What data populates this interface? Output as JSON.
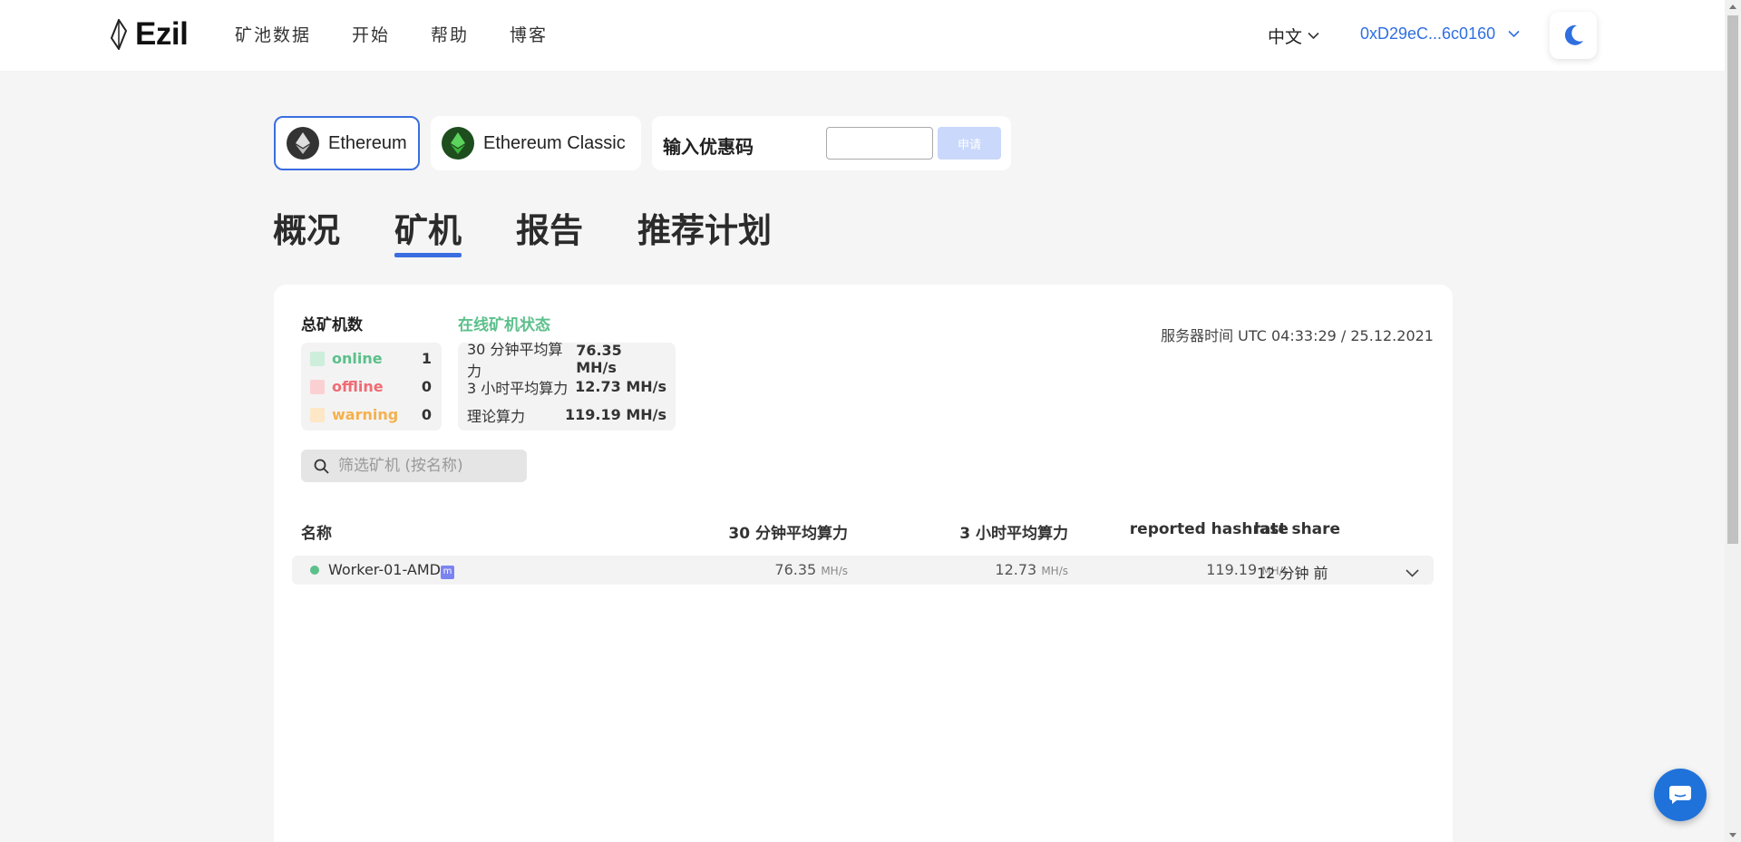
{
  "header": {
    "logo_text": "Ezil",
    "nav": [
      "矿池数据",
      "开始",
      "帮助",
      "博客"
    ],
    "language": "中文",
    "wallet": "0xD29eC...6c0160"
  },
  "coins": {
    "ethereum": "Ethereum",
    "ethereum_classic": "Ethereum Classic"
  },
  "promo": {
    "label": "输入优惠码",
    "input_value": "",
    "button": "申请"
  },
  "tabs": [
    {
      "label": "概况",
      "active": false
    },
    {
      "label": "矿机",
      "active": true
    },
    {
      "label": "报告",
      "active": false
    },
    {
      "label": "推荐计划",
      "active": false
    }
  ],
  "stats": {
    "totals_title": "总矿机数",
    "status_title": "在线矿机状态",
    "server_time": "服务器时间 UTC 04:33:29 / 25.12.2021",
    "totals": [
      {
        "label": "online",
        "value": "1",
        "color": "#5cc08b",
        "swatch": "#cdeedb"
      },
      {
        "label": "offline",
        "value": "0",
        "color": "#ef6b74",
        "swatch": "#fbd0d3"
      },
      {
        "label": "warning",
        "value": "0",
        "color": "#f5b14c",
        "swatch": "#fde7c6"
      }
    ],
    "status": [
      {
        "label": "30 分钟平均算力",
        "value": "76.35 MH/s"
      },
      {
        "label": "3 小时平均算力",
        "value": "12.73 MH/s"
      },
      {
        "label": "理论算力",
        "value": "119.19 MH/s"
      }
    ]
  },
  "search": {
    "placeholder": "筛选矿机 (按名称)"
  },
  "table": {
    "headers": {
      "name": "名称",
      "avg30": "30 分钟平均算力",
      "avg3h": "3 小时平均算力",
      "reported": "reported hashrate",
      "last_share": "last share"
    },
    "rows": [
      {
        "name": "Worker-01-AMD",
        "badge": "m",
        "avg30": "76.35",
        "avg3h": "12.73",
        "reported": "119.19",
        "unit": "MH/s",
        "last_share": "12 分钟 前"
      }
    ]
  }
}
